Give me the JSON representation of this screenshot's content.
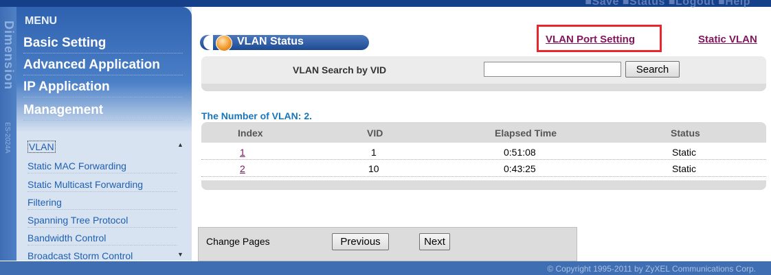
{
  "top_links": "■Save ■Status ■Logout ■Help",
  "brand": {
    "name": "Dimension",
    "model": "ES-2024A"
  },
  "menu": {
    "title": "MENU",
    "items": [
      {
        "label": "Basic Setting"
      },
      {
        "label": "Advanced Application"
      },
      {
        "label": "IP Application"
      },
      {
        "label": "Management"
      }
    ],
    "sub_items": [
      {
        "label": "VLAN",
        "active": true
      },
      {
        "label": "Static MAC Forwarding"
      },
      {
        "label": "Static Multicast Forwarding"
      },
      {
        "label": "Filtering"
      },
      {
        "label": "Spanning Tree Protocol"
      },
      {
        "label": "Bandwidth Control"
      },
      {
        "label": "Broadcast Storm Control"
      }
    ]
  },
  "page": {
    "title": "VLAN Status",
    "links": {
      "port_setting": "VLAN Port Setting",
      "static_vlan": "Static VLAN"
    }
  },
  "search": {
    "label": "VLAN Search by VID",
    "value": "",
    "button": "Search"
  },
  "summary": "The Number of VLAN: 2.",
  "table": {
    "headers": [
      "Index",
      "VID",
      "Elapsed Time",
      "Status"
    ],
    "rows": [
      {
        "index": "1",
        "vid": "1",
        "elapsed": "0:51:08",
        "status": "Static"
      },
      {
        "index": "2",
        "vid": "10",
        "elapsed": "0:43:25",
        "status": "Static"
      }
    ]
  },
  "pager": {
    "label": "Change Pages",
    "previous": "Previous",
    "next": "Next"
  },
  "footer": "© Copyright 1995-2011 by ZyXEL Communications Corp.",
  "colors": {
    "accent": "#1f5fb0",
    "link": "#80165c",
    "highlight": "#e8262b"
  }
}
